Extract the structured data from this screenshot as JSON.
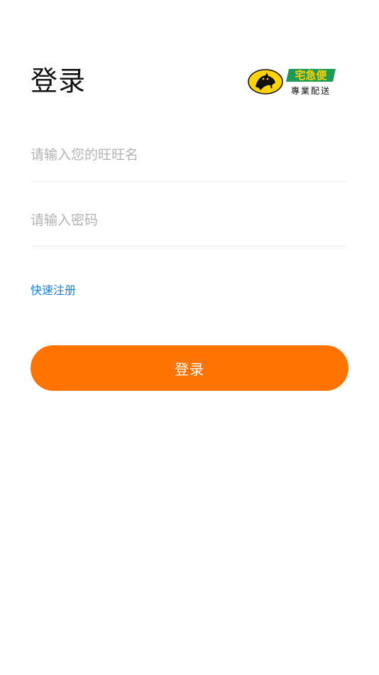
{
  "header": {
    "title": "登录",
    "logo": {
      "primary_text": "宅急便",
      "secondary_text": "專業配送",
      "colors": {
        "badge_green": "#1e9a57",
        "badge_yellow": "#ffd400",
        "cat_black": "#111111"
      }
    }
  },
  "form": {
    "username_placeholder": "请输入您的旺旺名",
    "username_value": "",
    "password_placeholder": "请输入密码",
    "password_value": ""
  },
  "links": {
    "register_label": "快速注册"
  },
  "actions": {
    "login_label": "登录"
  },
  "colors": {
    "accent": "#ff7302",
    "link": "#1a7fd6",
    "placeholder": "#b3b3b3",
    "divider": "#ededed"
  }
}
